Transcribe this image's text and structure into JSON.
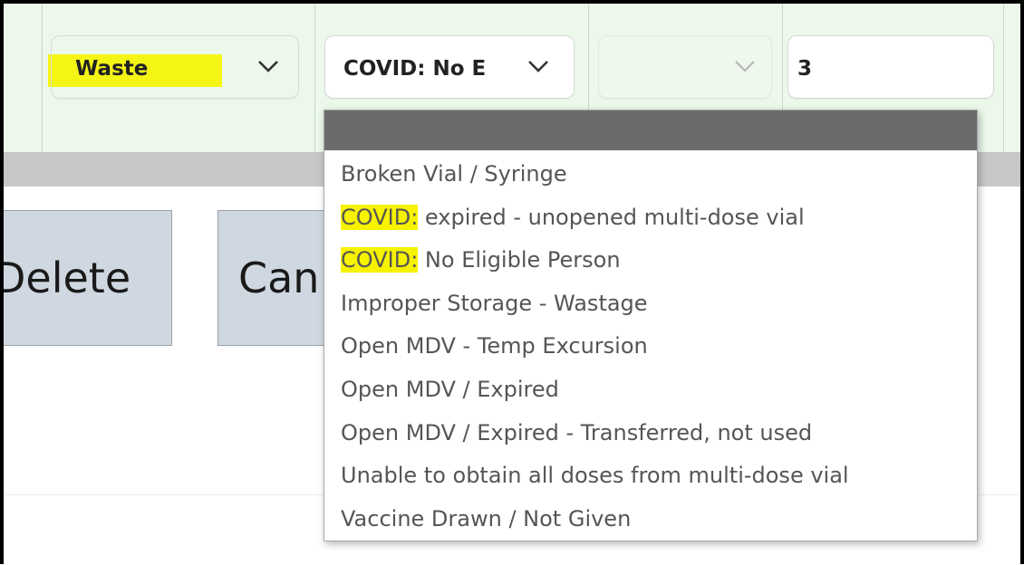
{
  "row": {
    "activity": {
      "value": "Waste"
    },
    "reason": {
      "value": "COVID: No E"
    },
    "lot": {
      "value": ""
    },
    "quantity": {
      "value": "3"
    }
  },
  "actions": {
    "delete_label": "Delete",
    "cancel_label": "Can"
  },
  "reason_dropdown": {
    "options": [
      {
        "prefix": "",
        "rest": "Broken Vial / Syringe"
      },
      {
        "prefix": "COVID:",
        "rest": " expired - unopened multi-dose vial"
      },
      {
        "prefix": "COVID:",
        "rest": " No Eligible Person"
      },
      {
        "prefix": "",
        "rest": "Improper Storage - Wastage"
      },
      {
        "prefix": "",
        "rest": "Open MDV - Temp Excursion"
      },
      {
        "prefix": "",
        "rest": "Open MDV / Expired"
      },
      {
        "prefix": "",
        "rest": "Open MDV / Expired - Transferred, not used"
      },
      {
        "prefix": "",
        "rest": "Unable to obtain all doses from multi-dose vial"
      },
      {
        "prefix": "",
        "rest": "Vaccine Drawn / Not Given"
      }
    ]
  },
  "colors": {
    "row_background": "#ebf8ea",
    "highlight": "#f5f515",
    "dropdown_header": "#6b6b6b",
    "button_background": "#cfd8e0"
  },
  "icons": {
    "select_arrow": "chevron-down-icon"
  }
}
